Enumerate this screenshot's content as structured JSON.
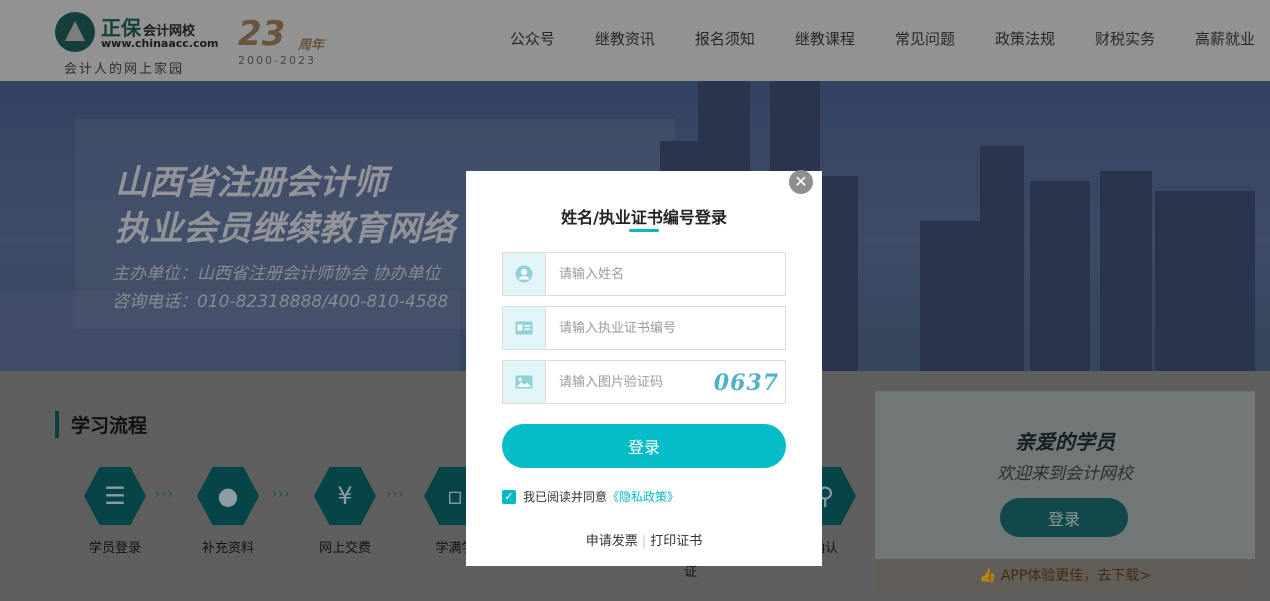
{
  "header": {
    "logo_brand": "正保",
    "logo_name": "会计网校",
    "logo_url": "www.chinaacc.com",
    "logo_slogan": "会计人的网上家园",
    "anniversary_number": "23",
    "anniversary_unit": "周年",
    "anniversary_years": "2000-2023",
    "nav": [
      "公众号",
      "继教资讯",
      "报名须知",
      "继教课程",
      "常见问题",
      "政策法规",
      "财税实务",
      "高薪就业"
    ]
  },
  "hero": {
    "title_line1": "山西省注册会计师",
    "title_line2": "执业会员继续教育网络",
    "organizer_line": "主办单位：山西省注册会计师协会   协办单位",
    "phone_line": "咨询电话：010-82318888/400-810-4588"
  },
  "process": {
    "title": "学习流程",
    "steps": [
      {
        "label": "学员登录",
        "icon": "clipboard-icon"
      },
      {
        "label": "补充资料",
        "icon": "user-check-icon"
      },
      {
        "label": "网上交费",
        "icon": "yuan-bag-icon"
      },
      {
        "label": "学满学",
        "icon": "id-card-icon"
      }
    ],
    "partial_label_right": "确认",
    "partial_label_bottom": "证"
  },
  "welcome": {
    "heading": "亲爱的学员",
    "subheading": "欢迎来到会计网校",
    "login_label": "登录",
    "app_link": "APP体验更佳，去下载>"
  },
  "modal": {
    "title": "姓名/执业证书编号登录",
    "close_symbol": "✕",
    "name_placeholder": "请输入姓名",
    "cert_placeholder": "请输入执业证书编号",
    "captcha_placeholder": "请输入图片验证码",
    "captcha_code": "0637",
    "login_label": "登录",
    "agree_text": "我已阅读并同意",
    "privacy_link": "《隐私政策》",
    "invoice_link": "申请发票",
    "certificate_link": "打印证书",
    "link_separator": "|"
  },
  "colors": {
    "accent": "#06bcc6",
    "brand_dark": "#1a5e61"
  }
}
